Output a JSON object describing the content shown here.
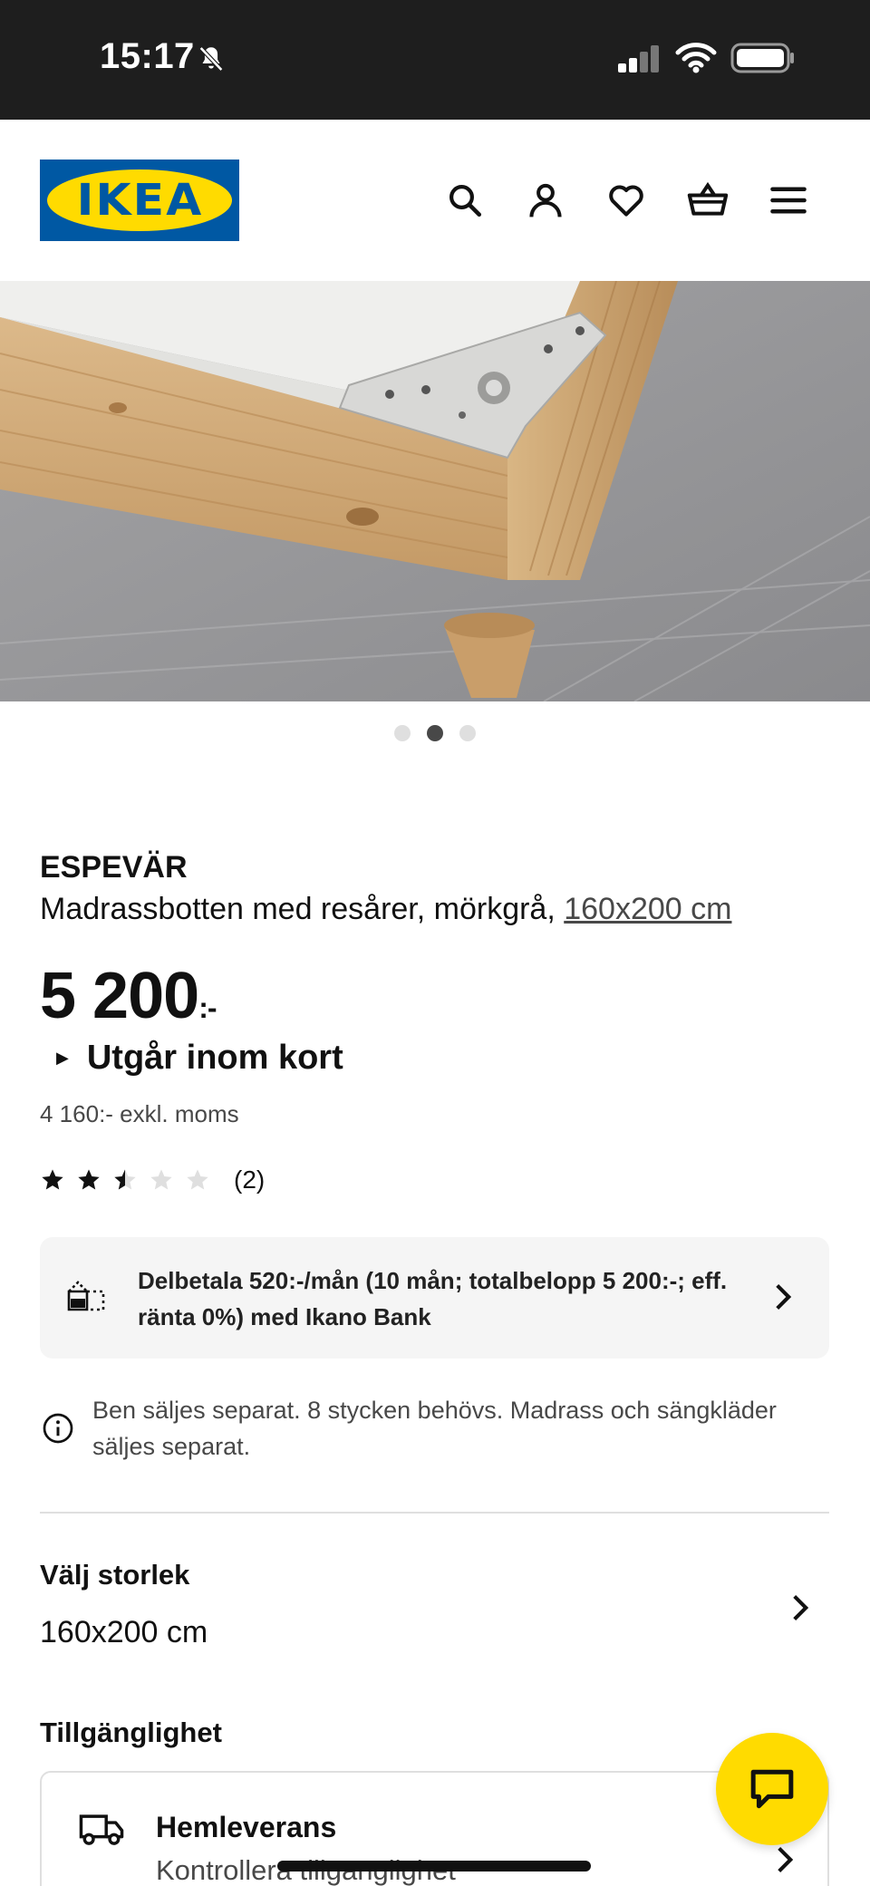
{
  "status_bar": {
    "time": "15:17"
  },
  "header": {
    "logo_text": "IKEA",
    "icons": [
      "search-icon",
      "account-icon",
      "heart-icon",
      "basket-icon",
      "menu-icon"
    ]
  },
  "carousel": {
    "image_count": 3,
    "active_index": 1
  },
  "product": {
    "name": "ESPEVÄR",
    "description": "Madrassbotten med resårer, mörkgrå, ",
    "size_link": "160x200 cm",
    "price": "5 200",
    "price_suffix": ":-",
    "stock_status": "Utgår inom kort",
    "ex_vat_price": "4 160:- exkl. moms",
    "rating_value": 2.5,
    "rating_max": 5,
    "rating_count": "(2)"
  },
  "financing": {
    "text": "Delbetala 520:-/mån (10 mån; totalbelopp 5 200:-; eff. ränta 0%) med Ikano Bank"
  },
  "info_note": {
    "text": "Ben säljes separat. 8 stycken behövs. Madrass och sängkläder säljes separat."
  },
  "size_section": {
    "label": "Välj storlek",
    "value": "160x200 cm"
  },
  "availability": {
    "label": "Tillgänglighet",
    "delivery_title": "Hemleverans",
    "delivery_sub": "Kontrollera tillgänglighet"
  },
  "colors": {
    "ikea_blue": "#0058a3",
    "ikea_yellow": "#ffdb00"
  }
}
